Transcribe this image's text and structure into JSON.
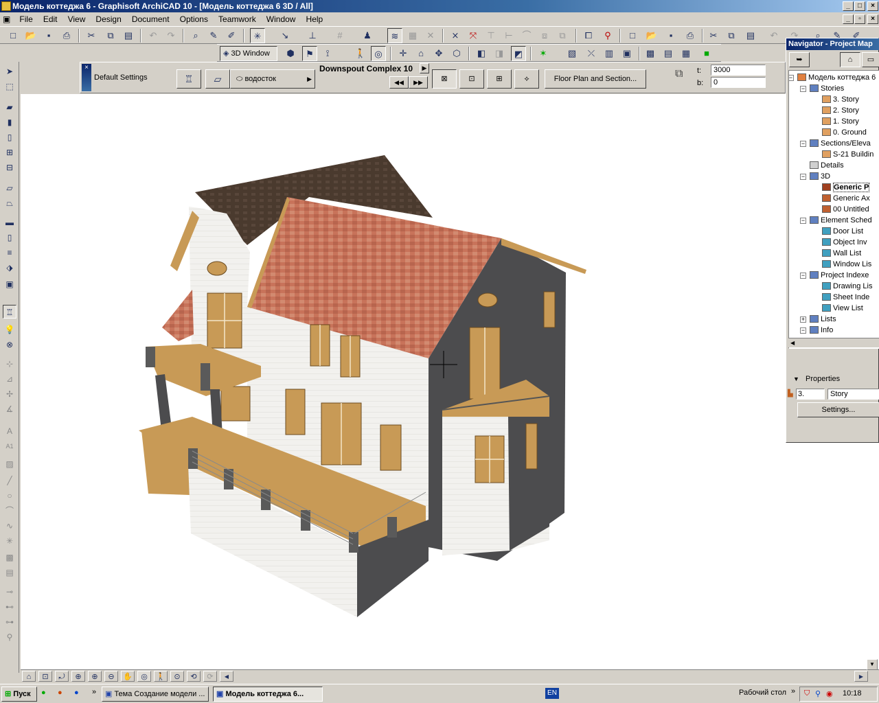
{
  "window": {
    "title": "Модель коттеджа 6 - Graphisoft ArchiCAD 10 - [Модель коттеджа 6 3D / All]"
  },
  "menu": {
    "items": [
      "File",
      "Edit",
      "View",
      "Design",
      "Document",
      "Options",
      "Teamwork",
      "Window",
      "Help"
    ]
  },
  "toolbar2": {
    "window_3d_label": "3D Window"
  },
  "infobox": {
    "default_settings": "Default Settings",
    "object_dropdown": "водосток",
    "object_name": "Downspout Complex 10",
    "floor_plan_button": "Floor Plan and Section...",
    "t_label": "t:",
    "t_value": "3000",
    "b_label": "b:",
    "b_value": "0"
  },
  "navigator": {
    "title": "Navigator - Project Map",
    "tree": [
      {
        "label": "Модель коттеджа 6",
        "level": 0,
        "icon": "house-icon",
        "expander": "−"
      },
      {
        "label": "Stories",
        "level": 1,
        "icon": "stories-icon",
        "expander": "−"
      },
      {
        "label": "3. Story",
        "level": 2,
        "icon": "story-icon",
        "expander": ""
      },
      {
        "label": "2. Story",
        "level": 2,
        "icon": "story-icon",
        "expander": ""
      },
      {
        "label": "1. Story",
        "level": 2,
        "icon": "story-icon",
        "expander": ""
      },
      {
        "label": "0. Ground",
        "level": 2,
        "icon": "story-icon",
        "expander": ""
      },
      {
        "label": "Sections/Eleva",
        "level": 1,
        "icon": "section-icon",
        "expander": "−"
      },
      {
        "label": "S-21 Buildin",
        "level": 2,
        "icon": "section-item-icon",
        "expander": ""
      },
      {
        "label": "Details",
        "level": 1,
        "icon": "details-icon",
        "expander": ""
      },
      {
        "label": "3D",
        "level": 1,
        "icon": "folder-3d-icon",
        "expander": "−"
      },
      {
        "label": "Generic P",
        "level": 2,
        "icon": "camera-icon",
        "expander": "",
        "selected": true
      },
      {
        "label": "Generic Ax",
        "level": 2,
        "icon": "axon-icon",
        "expander": ""
      },
      {
        "label": "00 Untitled",
        "level": 2,
        "icon": "path-icon",
        "expander": ""
      },
      {
        "label": "Element Sched",
        "level": 1,
        "icon": "schedule-icon",
        "expander": "−"
      },
      {
        "label": "Door List",
        "level": 2,
        "icon": "list-icon",
        "expander": ""
      },
      {
        "label": "Object Inv",
        "level": 2,
        "icon": "list-icon",
        "expander": ""
      },
      {
        "label": "Wall List",
        "level": 2,
        "icon": "list-icon",
        "expander": ""
      },
      {
        "label": "Window Lis",
        "level": 2,
        "icon": "list-icon",
        "expander": ""
      },
      {
        "label": "Project Indexe",
        "level": 1,
        "icon": "index-icon",
        "expander": "−"
      },
      {
        "label": "Drawing Lis",
        "level": 2,
        "icon": "list-icon",
        "expander": ""
      },
      {
        "label": "Sheet Inde",
        "level": 2,
        "icon": "list-icon",
        "expander": ""
      },
      {
        "label": "View List",
        "level": 2,
        "icon": "list-icon",
        "expander": ""
      },
      {
        "label": "Lists",
        "level": 1,
        "icon": "lists-icon",
        "expander": "+"
      },
      {
        "label": "Info",
        "level": 1,
        "icon": "info-icon",
        "expander": "−"
      }
    ],
    "properties_label": "Properties",
    "prop_id": "3.",
    "prop_name": "Story",
    "settings_button": "Settings..."
  },
  "taskbar": {
    "start_label": "Пуск",
    "tasks": [
      "Тема Создание модели ...",
      "Модель коттеджа 6..."
    ],
    "lang": "EN",
    "desktop_label": "Рабочий стол",
    "clock": "10:18"
  },
  "colors": {
    "title_start": "#0a246a",
    "title_end": "#a6caf0",
    "face": "#d4d0c8",
    "roof_tile": "#c8735a",
    "roof_dark": "#4a3a2e",
    "wall_light": "#f0efec",
    "wall_dark": "#4c4c4e",
    "trim_wood": "#c89a56"
  }
}
